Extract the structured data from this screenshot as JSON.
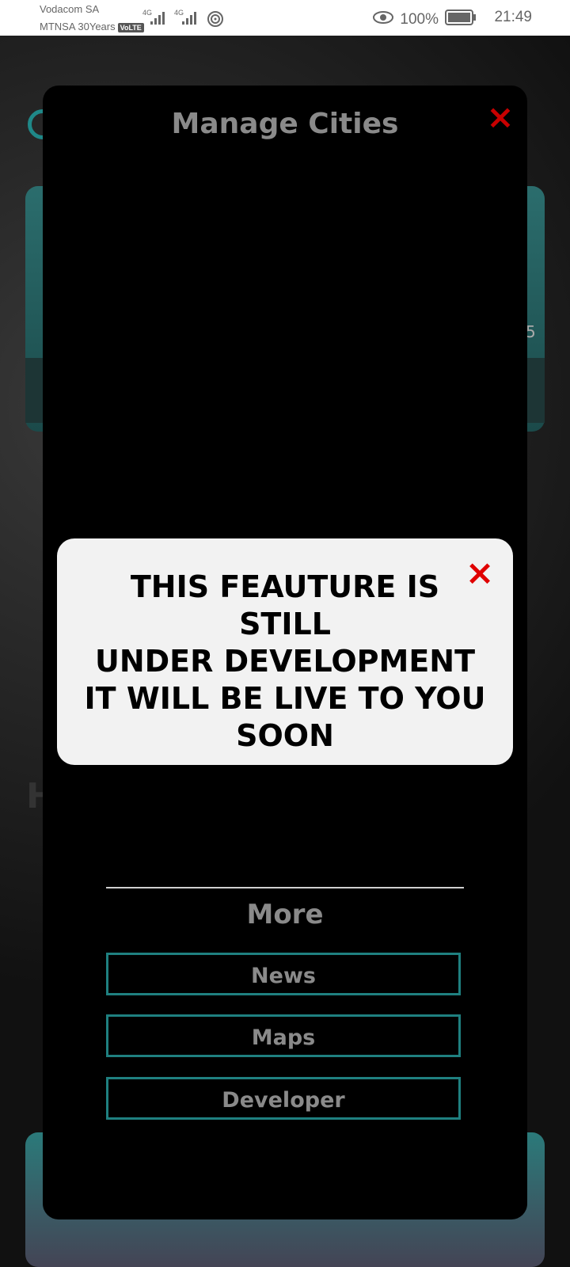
{
  "status_bar": {
    "carrier_1": "Vodacom SA",
    "carrier_2": "MTNSA 30Years",
    "volte_badge": "VoLTE",
    "network_1": "4G",
    "network_2": "4G",
    "battery_percent": "100%",
    "time": "21:49",
    "icons": [
      "signal-bars-icon",
      "hotspot-icon",
      "eye-icon",
      "battery-icon"
    ]
  },
  "background": {
    "partial_number": "5",
    "partial_letter": "H"
  },
  "manage_cities": {
    "title": "Manage Cities",
    "close_symbol": "×",
    "more_title": "More",
    "buttons": [
      "News",
      "Maps",
      "Developer"
    ]
  },
  "dialog": {
    "close_symbol": "×",
    "message_line_1": "THIS FEAUTURE IS STILL",
    "message_line_2": "UNDER DEVELOPMENT",
    "message_line_3": "IT WILL BE LIVE TO YOU",
    "message_line_4": "SOON"
  },
  "colors": {
    "accent_teal": "#1f8080",
    "close_red": "#e00000",
    "panel_bg": "#000000",
    "dialog_bg": "#f2f2f2"
  }
}
